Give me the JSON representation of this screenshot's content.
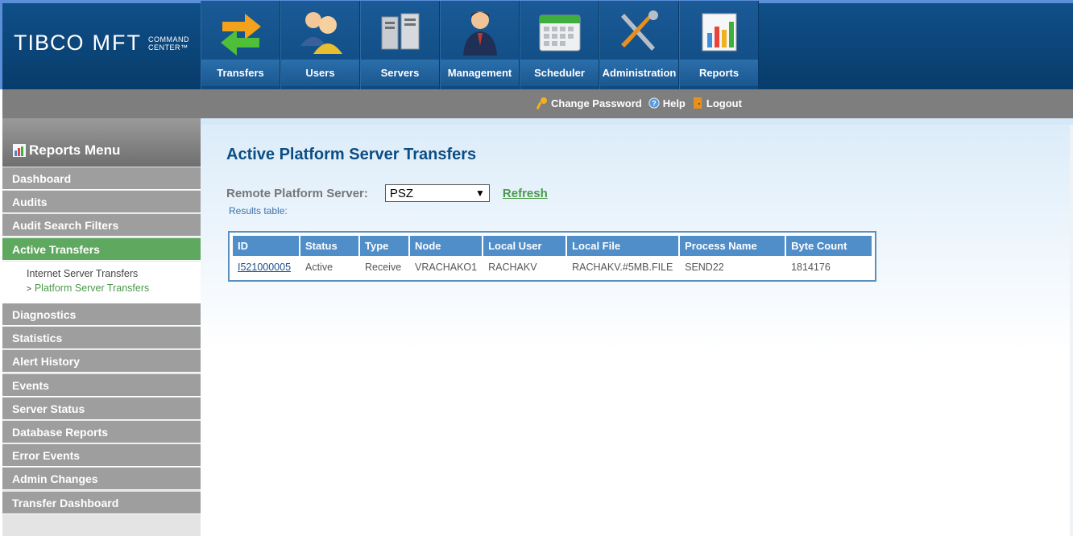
{
  "app": {
    "logo_brand": "TIBCO",
    "logo_product": "MFT",
    "logo_sub_line1": "COMMAND",
    "logo_sub_line2": "CENTER™"
  },
  "nav": [
    {
      "label": "Transfers",
      "icon": "transfers-arrows-icon"
    },
    {
      "label": "Users",
      "icon": "users-icon"
    },
    {
      "label": "Servers",
      "icon": "servers-icon"
    },
    {
      "label": "Management",
      "icon": "management-person-icon"
    },
    {
      "label": "Scheduler",
      "icon": "calendar-icon"
    },
    {
      "label": "Administration",
      "icon": "tools-icon"
    },
    {
      "label": "Reports",
      "icon": "bar-chart-icon"
    }
  ],
  "toplinks": {
    "change_password": "Change Password",
    "help": "Help",
    "logout": "Logout"
  },
  "sidebar": {
    "title": "Reports Menu",
    "items": [
      "Dashboard",
      "Audits",
      "Audit Search Filters",
      "Active Transfers",
      "Diagnostics",
      "Statistics",
      "Alert History",
      "Events",
      "Server Status",
      "Database Reports",
      "Error Events",
      "Admin Changes",
      "Transfer Dashboard"
    ],
    "active_index": 3,
    "sub_items": [
      "Internet Server Transfers",
      "Platform Server Transfers"
    ],
    "sub_active_index": 1
  },
  "main": {
    "title": "Active Platform Server Transfers",
    "remote_label": "Remote Platform Server:",
    "remote_value": "PSZ",
    "refresh_label": "Refresh",
    "results_caption": "Results table:",
    "columns": [
      "ID",
      "Status",
      "Type",
      "Node",
      "Local User",
      "Local File",
      "Process Name",
      "Byte Count"
    ],
    "rows": [
      [
        "I521000005",
        "Active",
        "Receive",
        "VRACHAKO1",
        "RACHAKV",
        "RACHAKV.#5MB.FILE",
        "SEND22",
        "1814176"
      ]
    ]
  },
  "colors": {
    "header_blue": "#0f4f88",
    "active_green": "#5fa85f",
    "table_header": "#4f8ec9",
    "title_blue": "#0c4d83"
  }
}
